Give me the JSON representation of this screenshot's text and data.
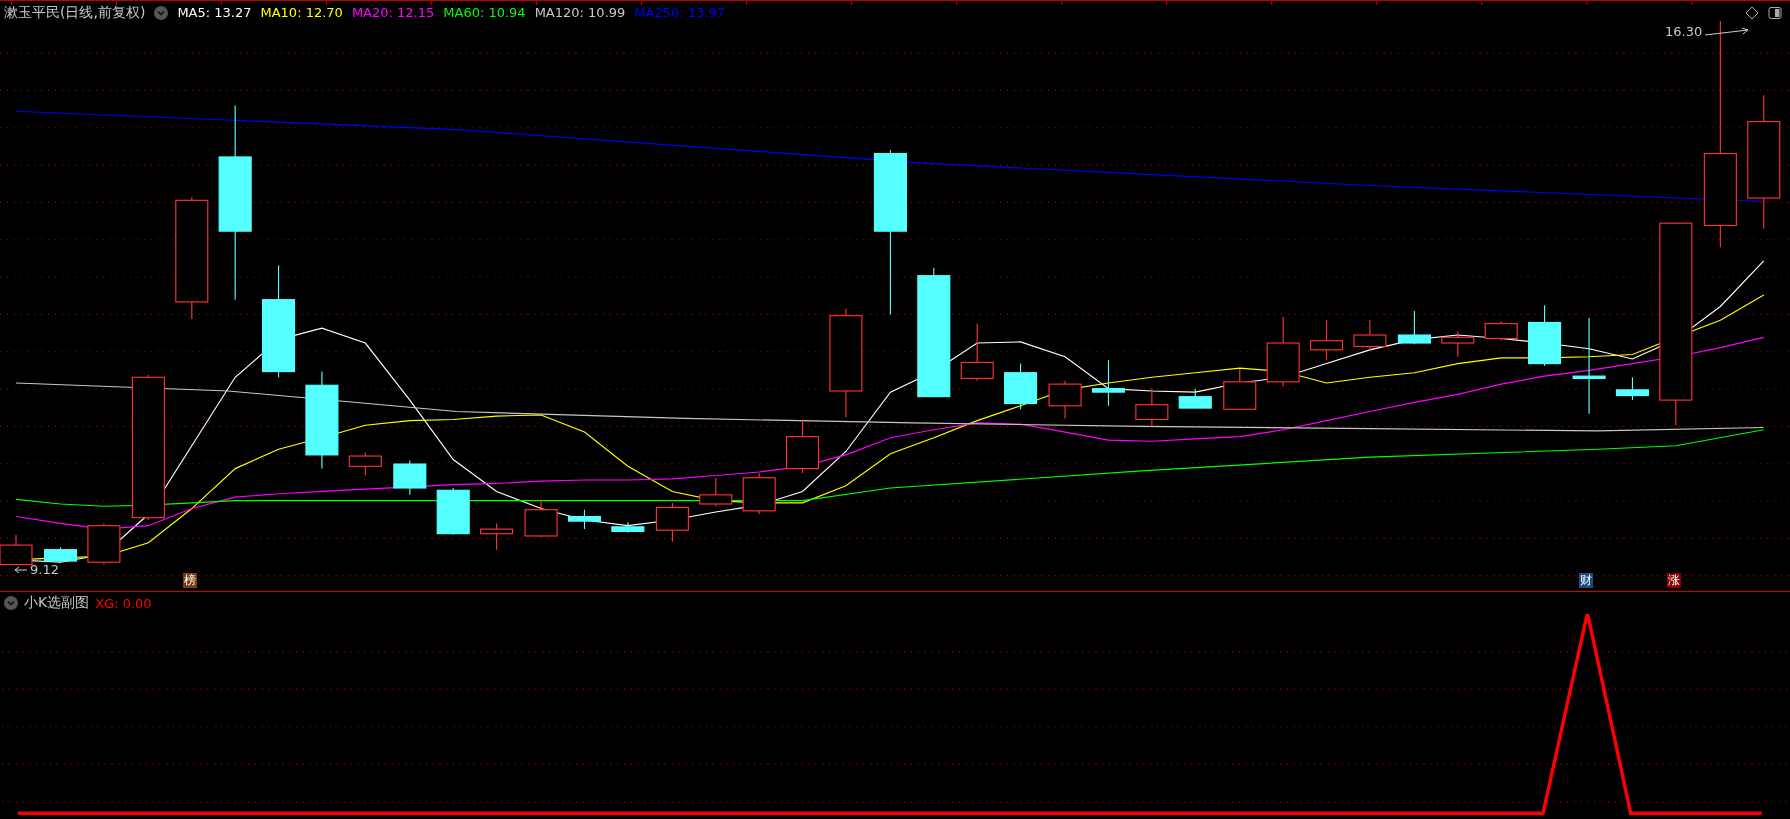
{
  "header": {
    "title": "漱玉平民(日线,前复权)",
    "indicators": [
      {
        "label": "MA5: 13.27",
        "color": "#ffffff"
      },
      {
        "label": "MA10: 12.70",
        "color": "#ffff00"
      },
      {
        "label": "MA20: 12.15",
        "color": "#ff00ff"
      },
      {
        "label": "MA60: 10.94",
        "color": "#00ff00"
      },
      {
        "label": "MA120: 10.99",
        "color": "#c8c8c8"
      },
      {
        "label": "MA250: 13.97",
        "color": "#0000ff"
      }
    ]
  },
  "price_chart": {
    "low_label": "9.12",
    "high_label": "16.30",
    "markers": [
      {
        "text": "榜",
        "color": "#7a3c10"
      },
      {
        "text": "财",
        "color": "#1a4a80"
      },
      {
        "text": "涨",
        "color": "#8b0000"
      }
    ]
  },
  "sub_chart": {
    "title": "小K选副图",
    "indicator": {
      "label": "XG: 0.00",
      "color": "#ff0000"
    }
  }
}
